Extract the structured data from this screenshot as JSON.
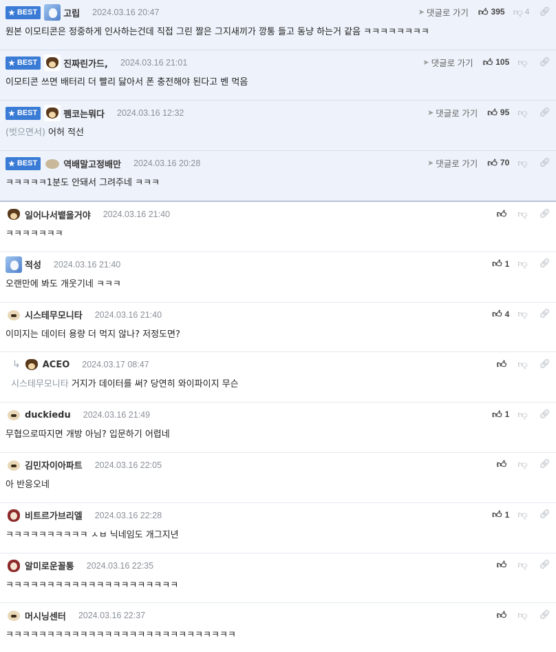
{
  "labels": {
    "best": "BEST",
    "reply": "댓글로 가기"
  },
  "comments": [
    {
      "best": true,
      "avatar": "av-blue",
      "nick": "고립",
      "date": "2024.03.16 20:47",
      "show_reply": true,
      "likes": "395",
      "dislikes": "4",
      "mention": "",
      "text": "원본 이모티콘은 정중하게 인사하는건데 직접 그린 짤은 그지새끼가 깡통 들고 동냥 하는거 같음 ㅋㅋㅋㅋㅋㅋㅋㅋ"
    },
    {
      "best": true,
      "avatar": "av-dog",
      "nick": "진짜린가드,",
      "date": "2024.03.16 21:01",
      "show_reply": true,
      "likes": "105",
      "dislikes": "",
      "mention": "",
      "text": "이모티콘 쓰면 배터리 더 빨리 닳아서 폰 충전해야 된다고 벤 먹음"
    },
    {
      "best": true,
      "avatar": "av-dog",
      "nick": "펨코는뭐다",
      "date": "2024.03.16 12:32",
      "show_reply": true,
      "likes": "95",
      "dislikes": "",
      "mention": "(벗으면서)",
      "text": "어허 적선"
    },
    {
      "best": true,
      "avatar": "av-blob",
      "nick": "역배말고정배만",
      "date": "2024.03.16 20:28",
      "show_reply": true,
      "likes": "70",
      "dislikes": "",
      "mention": "",
      "text": "ㅋㅋㅋㅋㅋ1분도 안돼서 그려주네 ㅋㅋㅋ"
    },
    {
      "best": false,
      "avatar": "av-dog",
      "nick": "일어나서뱉을거야",
      "date": "2024.03.16 21:40",
      "show_reply": false,
      "likes": "",
      "dislikes": "",
      "mention": "",
      "text": "ㅋㅋㅋㅋㅋㅋㅋ"
    },
    {
      "best": false,
      "avatar": "av-blue",
      "nick": "적성",
      "date": "2024.03.16 21:40",
      "show_reply": false,
      "likes": "1",
      "dislikes": "",
      "mention": "",
      "text": "오랜만에 봐도 개웃기네 ㅋㅋㅋ"
    },
    {
      "best": false,
      "avatar": "av-puppy",
      "nick": "시스테무모니타",
      "date": "2024.03.16 21:40",
      "show_reply": false,
      "likes": "4",
      "dislikes": "",
      "mention": "",
      "text": "이미지는 데이터 용량 더 먹지 않나? 저정도면?"
    },
    {
      "best": false,
      "reply": true,
      "avatar": "av-dog",
      "nick": "ACEO",
      "date": "2024.03.17 08:47",
      "show_reply": false,
      "likes": "",
      "dislikes": "",
      "mention": "시스테무모니타",
      "text": "거지가 데이터를 써? 당연히 와이파이지 무슨"
    },
    {
      "best": false,
      "avatar": "av-puppy",
      "nick": "duckiedu",
      "date": "2024.03.16 21:49",
      "show_reply": false,
      "likes": "1",
      "dislikes": "",
      "mention": "",
      "text": "무협으로따지면 개방 아님? 입문하기 어렵네"
    },
    {
      "best": false,
      "avatar": "av-puppy",
      "nick": "김민자이아파트",
      "date": "2024.03.16 22:05",
      "show_reply": false,
      "likes": "",
      "dislikes": "",
      "mention": "",
      "text": "아 반응오네"
    },
    {
      "best": false,
      "avatar": "av-red",
      "nick": "비트르가브리엘",
      "date": "2024.03.16 22:28",
      "show_reply": false,
      "likes": "1",
      "dislikes": "",
      "mention": "",
      "text": "ㅋㅋㅋㅋㅋㅋㅋㅋㅋㅋ ㅅㅂ 닉네임도 개그지년"
    },
    {
      "best": false,
      "avatar": "av-red",
      "nick": "알미로운꼴통",
      "date": "2024.03.16 22:35",
      "show_reply": false,
      "likes": "",
      "dislikes": "",
      "mention": "",
      "text": "ㅋㅋㅋㅋㅋㅋㅋㅋㅋㅋㅋㅋㅋㅋㅋㅋㅋㅋㅋㅋㅋ"
    },
    {
      "best": false,
      "avatar": "av-puppy",
      "nick": "머시닝센터",
      "date": "2024.03.16 22:37",
      "show_reply": false,
      "likes": "",
      "dislikes": "",
      "mention": "",
      "text": "ㅋㅋㅋㅋㅋㅋㅋㅋㅋㅋㅋㅋㅋㅋㅋㅋㅋㅋㅋㅋㅋㅋㅋㅋㅋㅋㅋㅋ"
    }
  ]
}
